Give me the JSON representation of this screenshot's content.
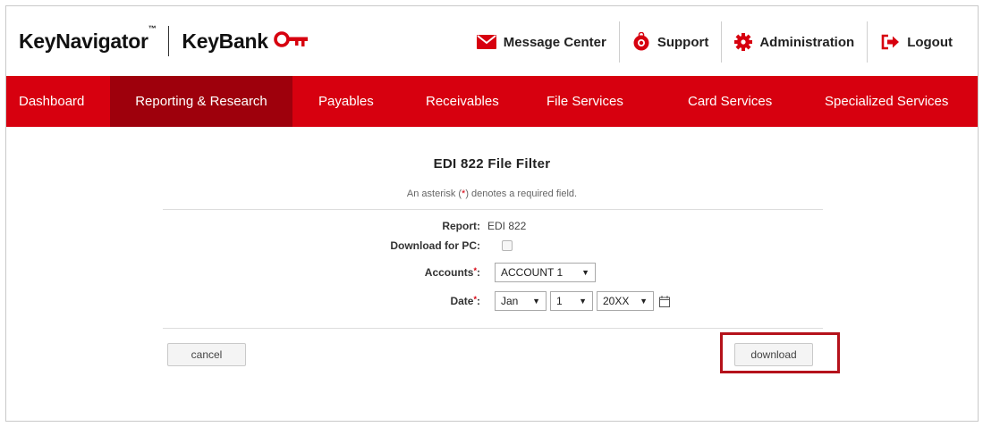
{
  "brand": {
    "product": "KeyNavigator",
    "product_tm": "™",
    "bank": "KeyBank",
    "brand_color": "#d7000f"
  },
  "top_nav": [
    {
      "label": "Message Center",
      "icon": "envelope-icon"
    },
    {
      "label": "Support",
      "icon": "lifebuoy-icon"
    },
    {
      "label": "Administration",
      "icon": "gear-icon"
    },
    {
      "label": "Logout",
      "icon": "logout-icon"
    }
  ],
  "main_nav": [
    {
      "label": "Dashboard",
      "active": false
    },
    {
      "label": "Reporting & Research",
      "active": true
    },
    {
      "label": "Payables",
      "active": false
    },
    {
      "label": "Receivables",
      "active": false
    },
    {
      "label": "File Services",
      "active": false
    },
    {
      "label": "Card Services",
      "active": false
    },
    {
      "label": "Specialized Services",
      "active": false
    }
  ],
  "form": {
    "title": "EDI 822 File Filter",
    "note_prefix": "An asterisk (",
    "note_star": "*",
    "note_suffix": ") denotes a required field.",
    "report_label": "Report:",
    "report_value": "EDI 822",
    "download_pc_label": "Download for PC:",
    "download_pc_checked": false,
    "accounts_label": "Accounts",
    "accounts_value": "ACCOUNT 1",
    "date_label": "Date",
    "required_mark": "*",
    "label_colon": ":",
    "date_month": "Jan",
    "date_day": "1",
    "date_year": "20XX",
    "cancel_label": "cancel",
    "download_label": "download",
    "highlight_color": "#b5121b"
  }
}
